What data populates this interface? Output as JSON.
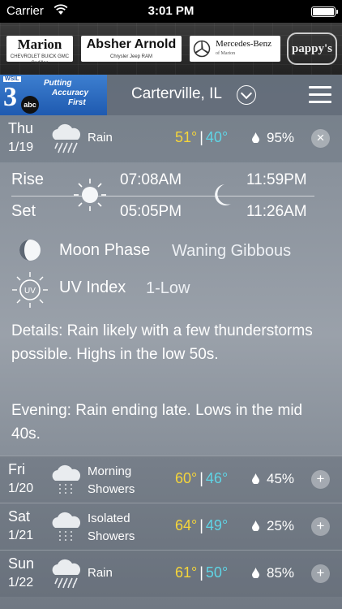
{
  "status_bar": {
    "carrier": "Carrier",
    "time": "3:01 PM"
  },
  "sponsors": {
    "marion": {
      "name": "Marion",
      "sub": "CHEVROLET BUICK GMC Cadillac"
    },
    "absher": {
      "name": "Absher Arnold",
      "sub": "Chrysler Jeep RAM"
    },
    "mercedes": {
      "name": "Mercedes-Benz",
      "sub": "of Marion"
    },
    "pappys": {
      "name": "pappy's"
    }
  },
  "header": {
    "station": {
      "call": "WSIL",
      "number": "3",
      "network": "abc",
      "tagline": [
        "Putting",
        "Accuracy",
        "First"
      ]
    },
    "location": "Carterville, IL"
  },
  "today": {
    "day": "Thu",
    "date": "1/19",
    "condition": "Rain",
    "high": "51°",
    "low": "40°",
    "precip": "95%",
    "close_glyph": "×",
    "sun_rise_label": "Rise",
    "sun_set_label": "Set",
    "sunrise": "07:08AM",
    "sunset": "05:05PM",
    "moonrise": "11:59PM",
    "moonset": "11:26AM",
    "moon_phase_label": "Moon Phase",
    "moon_phase": "Waning Gibbous",
    "uv_label": "UV Index",
    "uv_icon_text": "UV",
    "uv_value": "1-Low",
    "details": "Details: Rain likely with a few thunderstorms possible. Highs in the low 50s.",
    "evening": "Evening: Rain ending late. Lows in the mid 40s."
  },
  "forecast": [
    {
      "day": "Fri",
      "date": "1/20",
      "condition_1": "Morning",
      "condition_2": "Showers",
      "high": "60°",
      "low": "46°",
      "precip": "45%",
      "glyph": "+"
    },
    {
      "day": "Sat",
      "date": "1/21",
      "condition_1": "Isolated",
      "condition_2": "Showers",
      "high": "64°",
      "low": "49°",
      "precip": "25%",
      "glyph": "+"
    },
    {
      "day": "Sun",
      "date": "1/22",
      "condition_1": "Rain",
      "condition_2": "",
      "high": "61°",
      "low": "50°",
      "precip": "85%",
      "glyph": "+"
    }
  ],
  "colors": {
    "high_temp": "#f5d53a",
    "low_temp": "#5fd5e6"
  }
}
